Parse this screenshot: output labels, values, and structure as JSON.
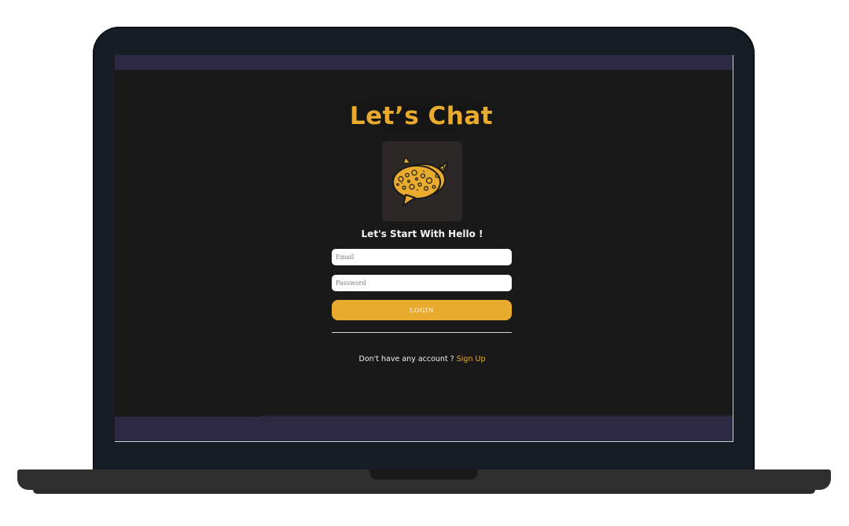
{
  "app": {
    "title": "Let’s Chat",
    "subtitle": "Let's Start With Hello !"
  },
  "form": {
    "email_placeholder": "Email",
    "email_value": "",
    "password_placeholder": "Password",
    "password_value": "",
    "login_label": "LOGIN"
  },
  "signup": {
    "prompt": "Don't have any account ?",
    "link_label": "Sign Up"
  },
  "colors": {
    "accent": "#e8ab2e",
    "screen_background": "#1a1919",
    "strip": "#2d2945",
    "logo_tile": "#2b2827"
  },
  "icons": {
    "logo": "chat-bubbles-icon"
  }
}
